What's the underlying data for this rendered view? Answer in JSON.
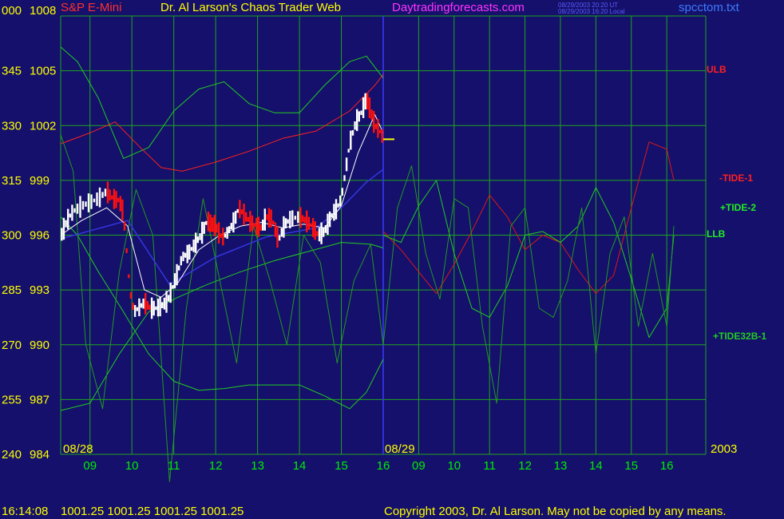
{
  "header": {
    "symbol": "S&P E-Mini",
    "title": "Dr. Al Larson's Chaos Trader Web",
    "site": "Daytradingforecasts.com",
    "stamp_line1": "08/29/2003 20:20 UT",
    "stamp_line2": "08/29/2003 16:20 Local",
    "filename": "spcctom.txt"
  },
  "footer": {
    "time": "16:14:08",
    "quote": "1001.25 1001.25 1001.25 1001.25",
    "copyright": "Copyright 2003, Dr. Al Larson. May not be copied by any means."
  },
  "colors": {
    "background": "#14106b",
    "grid": "#1fa51f",
    "axis_text": "#ffff00",
    "time_text": "#00ee00",
    "symbol": "#ff3030",
    "title": "#ffff00",
    "site": "#ff33ff",
    "filename": "#3d7bff",
    "ulb": "#ff2020",
    "tide1": "#dd1818",
    "tide2": "#22cc22",
    "llb": "#22cc22",
    "tide32b": "#229922",
    "envelope": "#22cc22",
    "price_up": "#ffffff",
    "price_down": "#ff1010",
    "moving_avg": "#ffffff",
    "trend": "#3535e0",
    "now_marker": "#ffff00"
  },
  "chart_data": {
    "type": "line",
    "title": "S&P E-Mini",
    "ylim": [
      984,
      1008
    ],
    "y_ticks": [
      {
        "angle": "000",
        "price": "1008",
        "value": 1008
      },
      {
        "angle": "345",
        "price": "1005",
        "value": 1005
      },
      {
        "angle": "330",
        "price": "1002",
        "value": 1002
      },
      {
        "angle": "315",
        "price": "999",
        "value": 999
      },
      {
        "angle": "300",
        "price": "996",
        "value": 996
      },
      {
        "angle": "285",
        "price": "993",
        "value": 993
      },
      {
        "angle": "270",
        "price": "990",
        "value": 990
      },
      {
        "angle": "255",
        "price": "987",
        "value": 987
      },
      {
        "angle": "240",
        "price": "984",
        "value": 984
      }
    ],
    "x_range": [
      8.3,
      17.1
    ],
    "x_divider": 16,
    "x_ticks_day1": [
      {
        "label": "09",
        "value": 9
      },
      {
        "label": "10",
        "value": 10
      },
      {
        "label": "11",
        "value": 11
      },
      {
        "label": "12",
        "value": 12
      },
      {
        "label": "13",
        "value": 13
      },
      {
        "label": "14",
        "value": 14
      },
      {
        "label": "15",
        "value": 15
      },
      {
        "label": "16",
        "value": 16
      }
    ],
    "x_ticks_day2": [
      {
        "label": "09",
        "value": 9
      },
      {
        "label": "10",
        "value": 10
      },
      {
        "label": "11",
        "value": 11
      },
      {
        "label": "12",
        "value": 12
      },
      {
        "label": "13",
        "value": 13
      },
      {
        "label": "14",
        "value": 14
      },
      {
        "label": "15",
        "value": 15
      },
      {
        "label": "16",
        "value": 16
      }
    ],
    "date_labels": [
      "08/28",
      "08/29",
      "2003"
    ],
    "legend": [
      {
        "name": "ULB",
        "color": "#ff2020"
      },
      {
        "name": "-TIDE-1",
        "color": "#ff2020"
      },
      {
        "name": "+TIDE-2",
        "color": "#22ee22"
      },
      {
        "name": "LLB",
        "color": "#22ee22"
      },
      {
        "name": "+TIDE32B-1",
        "color": "#22cc22"
      }
    ],
    "last_price": 1001.25,
    "price_bars": [
      {
        "x": 8.3,
        "v": 995.9
      },
      {
        "x": 8.4,
        "v": 996.5
      },
      {
        "x": 8.5,
        "v": 997.0
      },
      {
        "x": 8.6,
        "v": 997.3
      },
      {
        "x": 8.8,
        "v": 997.6
      },
      {
        "x": 9.0,
        "v": 997.8
      },
      {
        "x": 9.2,
        "v": 998.0
      },
      {
        "x": 9.4,
        "v": 998.4
      },
      {
        "x": 9.55,
        "v": 998.0
      },
      {
        "x": 9.7,
        "v": 997.9
      },
      {
        "x": 9.8,
        "v": 997.2
      },
      {
        "x": 9.85,
        "v": 995.8
      },
      {
        "x": 9.9,
        "v": 994.5
      },
      {
        "x": 9.95,
        "v": 993.0
      },
      {
        "x": 10.05,
        "v": 991.8
      },
      {
        "x": 10.15,
        "v": 992.0
      },
      {
        "x": 10.3,
        "v": 992.3
      },
      {
        "x": 10.45,
        "v": 992.0
      },
      {
        "x": 10.6,
        "v": 992.0
      },
      {
        "x": 10.75,
        "v": 992.2
      },
      {
        "x": 10.85,
        "v": 992.4
      },
      {
        "x": 10.95,
        "v": 993.0
      },
      {
        "x": 11.1,
        "v": 994.0
      },
      {
        "x": 11.2,
        "v": 994.8
      },
      {
        "x": 11.35,
        "v": 995.0
      },
      {
        "x": 11.5,
        "v": 995.5
      },
      {
        "x": 11.65,
        "v": 996.0
      },
      {
        "x": 11.8,
        "v": 996.8
      },
      {
        "x": 11.9,
        "v": 996.6
      },
      {
        "x": 12.0,
        "v": 996.5
      },
      {
        "x": 12.1,
        "v": 996.0
      },
      {
        "x": 12.2,
        "v": 995.9
      },
      {
        "x": 12.3,
        "v": 996.2
      },
      {
        "x": 12.45,
        "v": 996.8
      },
      {
        "x": 12.55,
        "v": 997.5
      },
      {
        "x": 12.65,
        "v": 997.2
      },
      {
        "x": 12.8,
        "v": 996.8
      },
      {
        "x": 12.95,
        "v": 996.5
      },
      {
        "x": 13.1,
        "v": 996.4
      },
      {
        "x": 13.2,
        "v": 997.0
      },
      {
        "x": 13.35,
        "v": 996.9
      },
      {
        "x": 13.5,
        "v": 995.7
      },
      {
        "x": 13.65,
        "v": 996.6
      },
      {
        "x": 13.8,
        "v": 996.9
      },
      {
        "x": 14.0,
        "v": 997.0
      },
      {
        "x": 14.15,
        "v": 996.8
      },
      {
        "x": 14.3,
        "v": 996.5
      },
      {
        "x": 14.45,
        "v": 996.0
      },
      {
        "x": 14.6,
        "v": 996.2
      },
      {
        "x": 14.75,
        "v": 997.0
      },
      {
        "x": 14.9,
        "v": 997.5
      },
      {
        "x": 15.0,
        "v": 998.0
      },
      {
        "x": 15.1,
        "v": 999.5
      },
      {
        "x": 15.2,
        "v": 1001.0
      },
      {
        "x": 15.35,
        "v": 1002.2
      },
      {
        "x": 15.5,
        "v": 1002.8
      },
      {
        "x": 15.6,
        "v": 1003.5
      },
      {
        "x": 15.7,
        "v": 1002.8
      },
      {
        "x": 15.8,
        "v": 1002.0
      },
      {
        "x": 15.9,
        "v": 1001.8
      },
      {
        "x": 16.0,
        "v": 1001.3
      }
    ],
    "series": [
      {
        "name": "ULB",
        "x": [
          8.3,
          9.0,
          9.6,
          10.2,
          10.7,
          11.2,
          12.0,
          12.8,
          13.6,
          14.4,
          15.2,
          15.8,
          16.0
        ],
        "values": [
          1001.0,
          1001.6,
          1002.2,
          1000.8,
          999.7,
          999.5,
          1000.0,
          1000.6,
          1001.3,
          1001.7,
          1002.8,
          1004.2,
          1004.8
        ]
      },
      {
        "name": "LLB",
        "x": [
          8.3,
          9.0,
          9.7,
          10.4,
          11.1,
          11.8,
          12.6,
          13.4,
          14.2,
          15.0,
          15.7,
          16.0
        ],
        "values": [
          986.4,
          986.8,
          989.5,
          991.8,
          992.6,
          993.3,
          994.0,
          994.6,
          995.1,
          995.6,
          995.5,
          995.3
        ]
      },
      {
        "name": "-TIDE-1",
        "x": [
          16.0,
          16.5,
          17.0,
          17.5,
          18.0,
          18.5,
          19.0,
          19.5,
          20.0,
          20.5,
          21.0,
          21.5,
          22.0,
          22.5,
          23.0,
          23.5,
          24.0,
          24.2
        ],
        "values": [
          996.2,
          995.2,
          994.0,
          992.8,
          994.4,
          996.2,
          998.2,
          997.0,
          995.2,
          996.0,
          995.6,
          994.1,
          992.8,
          993.8,
          997.5,
          1001.1,
          1000.7,
          999.0
        ]
      },
      {
        "name": "+TIDE-2",
        "x": [
          16.0,
          16.5,
          17.0,
          17.5,
          18.0,
          18.5,
          19.0,
          19.5,
          20.0,
          20.5,
          21.0,
          21.5,
          22.0,
          22.5,
          23.0,
          23.5,
          24.0,
          24.2
        ],
        "values": [
          996.0,
          995.6,
          997.6,
          999.0,
          995.0,
          992.0,
          991.5,
          993.2,
          996.0,
          996.2,
          995.6,
          996.5,
          998.6,
          996.7,
          993.6,
          990.4,
          992.0,
          996.0
        ]
      },
      {
        "name": "+TIDE32B-1",
        "x": [
          8.3,
          8.6,
          8.9,
          9.3,
          9.7,
          10.1,
          10.5,
          10.9,
          11.3,
          11.7,
          12.1,
          12.5,
          12.9,
          13.3,
          13.7,
          14.1,
          14.5,
          14.9,
          15.3,
          15.7,
          16.0,
          16.4,
          16.8,
          17.2,
          17.6,
          18.0,
          18.4,
          18.8,
          19.2,
          19.6,
          20.0,
          20.4,
          20.8,
          21.2,
          21.6,
          22.0,
          22.4,
          22.8,
          23.2,
          23.6,
          24.0,
          24.2
        ],
        "values": [
          1001.5,
          999.5,
          990.0,
          986.5,
          994.0,
          998.5,
          996.0,
          982.5,
          992.0,
          998.0,
          993.5,
          989.0,
          996.5,
          993.5,
          990.0,
          996.0,
          994.5,
          989.0,
          993.5,
          995.5,
          990.0,
          997.5,
          999.8,
          995.0,
          992.5,
          998.0,
          997.5,
          991.0,
          986.8,
          996.5,
          997.5,
          992.0,
          991.5,
          993.5,
          997.5,
          989.5,
          995.0,
          997.0,
          991.0,
          995.0,
          991.0,
          996.5
        ]
      }
    ],
    "envelope_upper": {
      "x": [
        8.3,
        8.7,
        9.2,
        9.8,
        10.4,
        11.0,
        11.6,
        12.2,
        12.8,
        13.4,
        14.0,
        14.6,
        15.2,
        15.6,
        16.0
      ],
      "values": [
        1006.3,
        1005.5,
        1003.5,
        1000.2,
        1000.8,
        1002.8,
        1004.0,
        1004.4,
        1003.2,
        1002.7,
        1002.7,
        1004.2,
        1005.5,
        1005.8,
        1004.6
      ]
    },
    "envelope_lower": {
      "x": [
        8.3,
        8.7,
        9.2,
        9.8,
        10.4,
        11.0,
        11.6,
        12.2,
        12.8,
        13.4,
        14.0,
        14.6,
        15.2,
        15.6,
        16.0
      ],
      "values": [
        997.0,
        996.0,
        994.0,
        991.8,
        989.5,
        988.0,
        987.5,
        987.6,
        987.8,
        987.8,
        987.8,
        987.2,
        986.5,
        987.4,
        989.2
      ]
    },
    "moving_average": {
      "x": [
        8.3,
        8.8,
        9.4,
        9.9,
        10.3,
        10.7,
        11.1,
        11.6,
        12.1,
        12.6,
        13.1,
        13.6,
        14.1,
        14.6,
        15.0,
        15.4,
        15.8,
        16.0
      ],
      "values": [
        996.0,
        996.8,
        997.5,
        996.5,
        993.0,
        992.6,
        993.4,
        995.2,
        996.0,
        996.5,
        996.7,
        996.4,
        996.6,
        996.4,
        997.6,
        1000.5,
        1002.6,
        1001.6
      ]
    },
    "trend_line": {
      "x": [
        8.3,
        9.9,
        10.9,
        12.0,
        13.2,
        14.4,
        15.0,
        15.6,
        16.0
      ],
      "values": [
        995.8,
        996.8,
        993.3,
        994.8,
        995.9,
        996.4,
        997.5,
        998.9,
        999.6
      ]
    }
  }
}
